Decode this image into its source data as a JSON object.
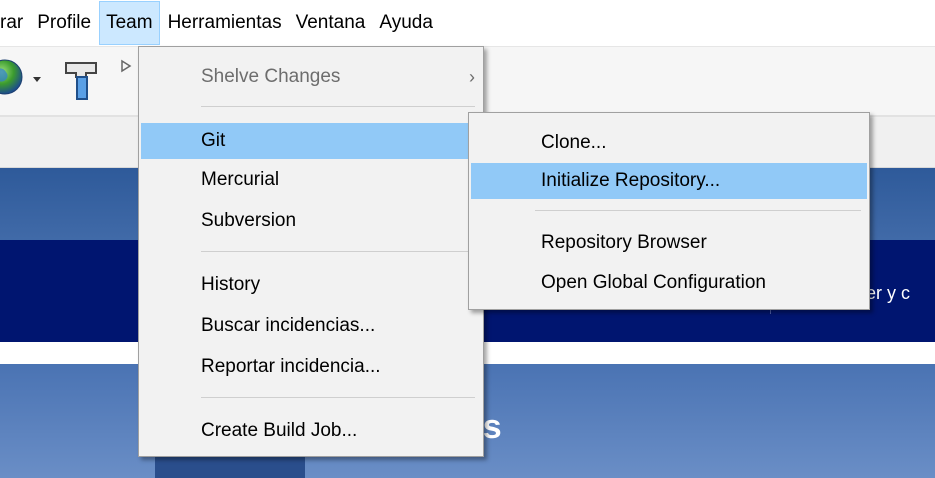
{
  "menubar": {
    "items": [
      {
        "label": "rar"
      },
      {
        "label": "Profile"
      },
      {
        "label": "Team",
        "active": true
      },
      {
        "label": "Herramientas"
      },
      {
        "label": "Ventana"
      },
      {
        "label": "Ayuda"
      }
    ]
  },
  "toolbar": {
    "icons": [
      "globe-icon",
      "dropdown-arrow-icon",
      "hammer-icon",
      "play-icon"
    ]
  },
  "team_menu": {
    "items": [
      {
        "label": "Shelve Changes",
        "disabled": true,
        "has_submenu": true
      },
      {
        "label": "Git",
        "highlighted": true,
        "has_submenu": true
      },
      {
        "label": "Mercurial",
        "has_submenu": true
      },
      {
        "label": "Subversion",
        "has_submenu": true
      },
      {
        "label": "History",
        "has_submenu": true
      },
      {
        "label": "Buscar incidencias..."
      },
      {
        "label": "Reportar incidencia..."
      },
      {
        "label": "Create Build Job..."
      }
    ]
  },
  "git_menu": {
    "items": [
      {
        "label": "Clone..."
      },
      {
        "label": "Initialize Repository...",
        "highlighted": true
      },
      {
        "label": "Repository Browser"
      },
      {
        "label": "Open Global Configuration"
      }
    ]
  },
  "background": {
    "nav_text": "der y c",
    "big_text": "ns"
  },
  "colors": {
    "menu_bg": "#f2f2f2",
    "highlight": "#91c9f7",
    "menubar_active": "#cce8ff",
    "nav_band": "#001570"
  }
}
